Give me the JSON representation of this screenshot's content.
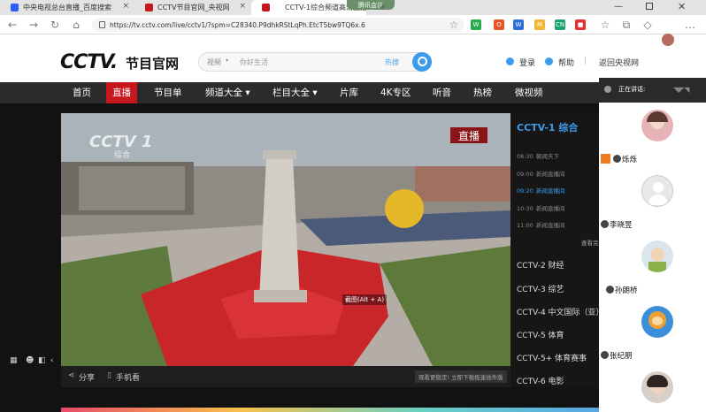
{
  "browser": {
    "tabs": [
      {
        "title": "中央电视总台直播_百度搜索",
        "active": false
      },
      {
        "title": "CCTV节目官网_央视网",
        "active": false
      },
      {
        "title": "CCTV-1综合频道高清直播",
        "active": true
      }
    ],
    "meeting_pill": "腾讯会议",
    "url": "https://tv.cctv.com/live/cctv1/?spm=C28340.P9dhkRStLqPh.EtcT5bw9TQ6x.6"
  },
  "header": {
    "logo": "CCTV.",
    "logo_sub": "节目官网",
    "search_select": "视频",
    "search_placeholder": "你好生活",
    "search_hot": "热搜",
    "login": "登录",
    "help": "帮助",
    "sep": "|",
    "back": "返回央视网"
  },
  "nav": {
    "items": [
      {
        "label": "首页"
      },
      {
        "label": "直播"
      },
      {
        "label": "节目单"
      },
      {
        "label": "频道大全 ▾"
      },
      {
        "label": "栏目大全 ▾"
      },
      {
        "label": "片库"
      },
      {
        "label": "4K专区"
      },
      {
        "label": "听音"
      },
      {
        "label": "热榜"
      },
      {
        "label": "微视频"
      }
    ]
  },
  "player": {
    "logo": "CCTV 1",
    "logo_sub": "综合",
    "live_badge": "直播",
    "tooltip": "截图(Alt + A)",
    "share": "分享",
    "mobile": "手机看",
    "notice": "观看更稳定! 立即下载极速插件版"
  },
  "channel_panel": {
    "current": "CCTV-1 综合",
    "schedule": [
      {
        "time": "08:30",
        "title": "朝闻天下",
        "current": false
      },
      {
        "time": "09:00",
        "title": "新闻直播间",
        "current": false
      },
      {
        "time": "09:20",
        "title": "新闻直播间",
        "current": true
      },
      {
        "time": "10:30",
        "title": "新闻直播间",
        "current": false
      },
      {
        "time": "11:00",
        "title": "新闻直播间",
        "current": false
      }
    ],
    "view_full": "查看完",
    "channels": [
      "CCTV-2 财经",
      "CCTV-3 综艺",
      "CCTV-4 中文国际（亚）",
      "CCTV-5 体育",
      "CCTV-5+ 体育赛事",
      "CCTV-6 电影"
    ]
  },
  "meeting": {
    "speaking_label": "正在讲话:",
    "participants": [
      {
        "name": "烁烁"
      },
      {
        "name": "李晓昱"
      },
      {
        "name": "孙朗桥"
      },
      {
        "name": "张纪朋"
      }
    ]
  },
  "colors": {
    "accent_red": "#c8161d",
    "nav_bg": "#2b2b2b",
    "channel_blue": "#3d9be9"
  }
}
